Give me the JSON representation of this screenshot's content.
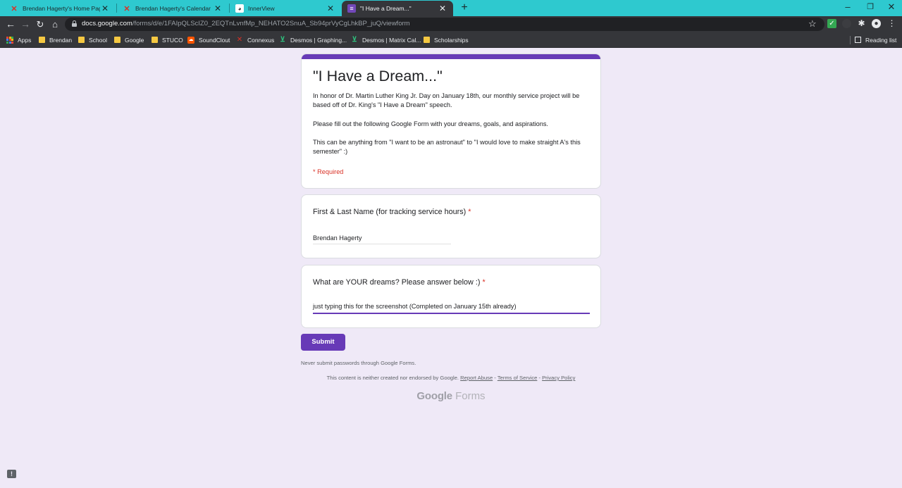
{
  "browser": {
    "tabs": [
      {
        "title": "Brendan Hagerty's Home Page",
        "icon": "connexus-icon",
        "active": false
      },
      {
        "title": "Brendan Hagerty's Calendar",
        "icon": "connexus-icon",
        "active": false
      },
      {
        "title": "InnerView",
        "icon": "innerview-icon",
        "active": false
      },
      {
        "title": "\"I Have a Dream...\"",
        "icon": "google-forms-icon",
        "active": true
      }
    ],
    "url_host": "docs.google.com",
    "url_path": "/forms/d/e/1FAIpQLScIZ0_2EQTnLvnfMp_NEHATO2SnuA_Sb94prVyCgLhkBP_juQ/viewform",
    "bookmarks": [
      {
        "label": "Apps",
        "icon": "apps-grid-icon"
      },
      {
        "label": "Brendan",
        "icon": "folder-icon"
      },
      {
        "label": "School",
        "icon": "folder-icon"
      },
      {
        "label": "Google",
        "icon": "folder-icon"
      },
      {
        "label": "STUCO",
        "icon": "folder-icon"
      },
      {
        "label": "SoundClout",
        "icon": "soundcloud-icon"
      },
      {
        "label": "Connexus",
        "icon": "connexus-icon"
      },
      {
        "label": "Desmos | Graphing...",
        "icon": "desmos-icon"
      },
      {
        "label": "Desmos | Matrix Cal...",
        "icon": "desmos-icon"
      },
      {
        "label": "Scholarships",
        "icon": "folder-icon"
      }
    ],
    "reading_list": "Reading list",
    "colors": {
      "tab_strip": "#2ec9cf",
      "toolbar": "#35363a"
    }
  },
  "form": {
    "title": "\"I Have a Dream...\"",
    "description": [
      "In honor of Dr. Martin Luther King Jr. Day on January 18th, our monthly service project will be based off of Dr. King's \"I Have a Dream\" speech.",
      "Please fill out the following Google Form with your dreams, goals, and aspirations.",
      "This can be anything from \"I want to be an astronaut\" to \"I would love to make straight A's this semester\" :)"
    ],
    "required_note": "* Required",
    "questions": [
      {
        "label": "First & Last Name (for tracking service hours)",
        "required_mark": "*",
        "answer": "Brendan Hagerty"
      },
      {
        "label": "What are YOUR dreams? Please answer below :)",
        "required_mark": "*",
        "answer": "just typing this for the screenshot (Completed on January 15th already)"
      }
    ],
    "submit_label": "Submit",
    "never_submit": "Never submit passwords through Google Forms.",
    "disclaimer": {
      "text": "This content is neither created nor endorsed by Google.",
      "report_abuse": "Report Abuse",
      "sep": " - ",
      "terms": "Terms of Service",
      "privacy": "Privacy Policy"
    },
    "brand_google": "Google",
    "brand_forms": "Forms",
    "colors": {
      "accent": "#673ab7",
      "page_bg": "#efe9f7",
      "required": "#d93025"
    }
  }
}
